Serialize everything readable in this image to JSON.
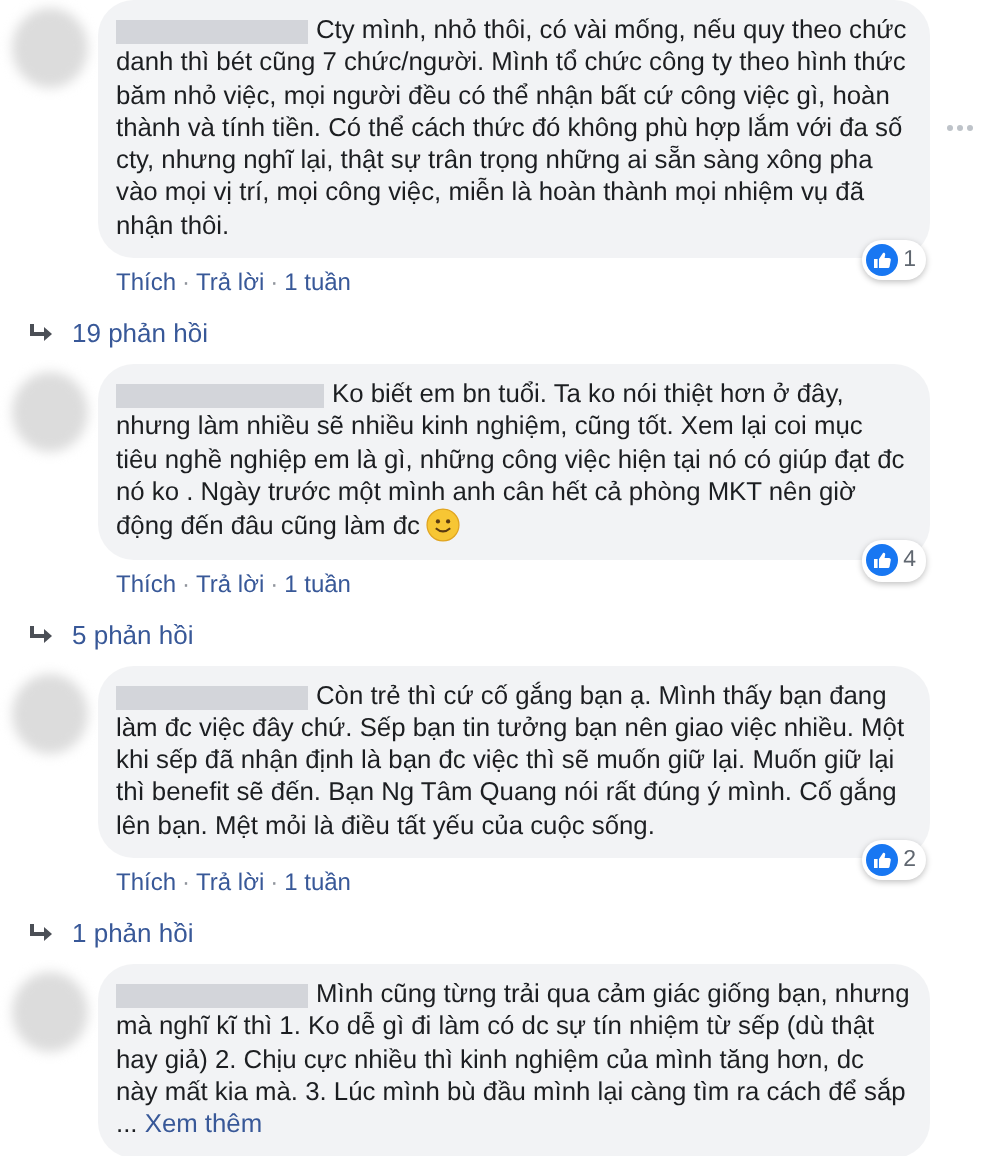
{
  "separator": "·",
  "comments": [
    {
      "text": "Cty mình, nhỏ thôi, có vài mống, nếu quy theo chức danh thì bét cũng 7 chức/người. Mình tổ chức công ty theo hình thức băm nhỏ việc, mọi người đều có thể nhận bất cứ công việc gì, hoàn thành và tính tiền. Có thể cách thức đó không phù hợp lắm với đa số cty, nhưng nghĩ lại, thật sự trân trọng những ai sẵn sàng xông pha vào mọi vị trí, mọi công việc, miễn là hoàn thành mọi nhiệm vụ đã nhận thôi.",
      "menu": true,
      "reactions": "1",
      "actions": [
        "Thích",
        "Trả lời"
      ],
      "time": "1 tuần",
      "replies": "19 phản hồi"
    },
    {
      "text": "Ko biết em bn tuổi. Ta ko nói thiệt hơn ở đây, nhưng làm nhiều sẽ nhiều kinh nghiệm, cũng tốt. Xem lại coi mục tiêu nghề nghiệp em là gì, những công việc hiện tại nó có giúp đạt đc nó ko . Ngày trước một mình anh cân hết cả phòng MKT nên giờ động đến đâu cũng làm đc",
      "smiley": true,
      "menu": false,
      "reactions": "4",
      "actions": [
        "Thích",
        "Trả lời"
      ],
      "time": "1 tuần",
      "replies": "5 phản hồi"
    },
    {
      "text": "Còn trẻ thì cứ cố gắng bạn ạ. Mình thấy bạn đang làm đc việc đây chứ. Sếp bạn tin tưởng bạn nên giao việc nhiều. Một khi sếp đã nhận định là bạn đc việc thì sẽ muốn giữ lại. Muốn giữ lại thì benefit sẽ đến. Bạn Ng Tâm Quang nói rất đúng ý mình. Cố gắng lên bạn. Mệt mỏi là điều tất yếu của cuộc sống.",
      "menu": false,
      "reactions": "2",
      "actions": [
        "Thích",
        "Trả lời"
      ],
      "time": "1 tuần",
      "replies": "1 phản hồi"
    },
    {
      "text": "Mình cũng từng trải qua cảm giác giống bạn, nhưng mà nghĩ kĩ thì 1. Ko dễ gì đi làm có dc sự tín nhiệm từ sếp (dù thật hay giả) 2. Chịu cực nhiều thì kinh nghiệm của mình tăng hơn, dc này mất kia mà. 3. Lúc mình bù đầu mình lại càng tìm ra cách để sắp ...",
      "see_more": "Xem thêm",
      "menu": false
    }
  ]
}
